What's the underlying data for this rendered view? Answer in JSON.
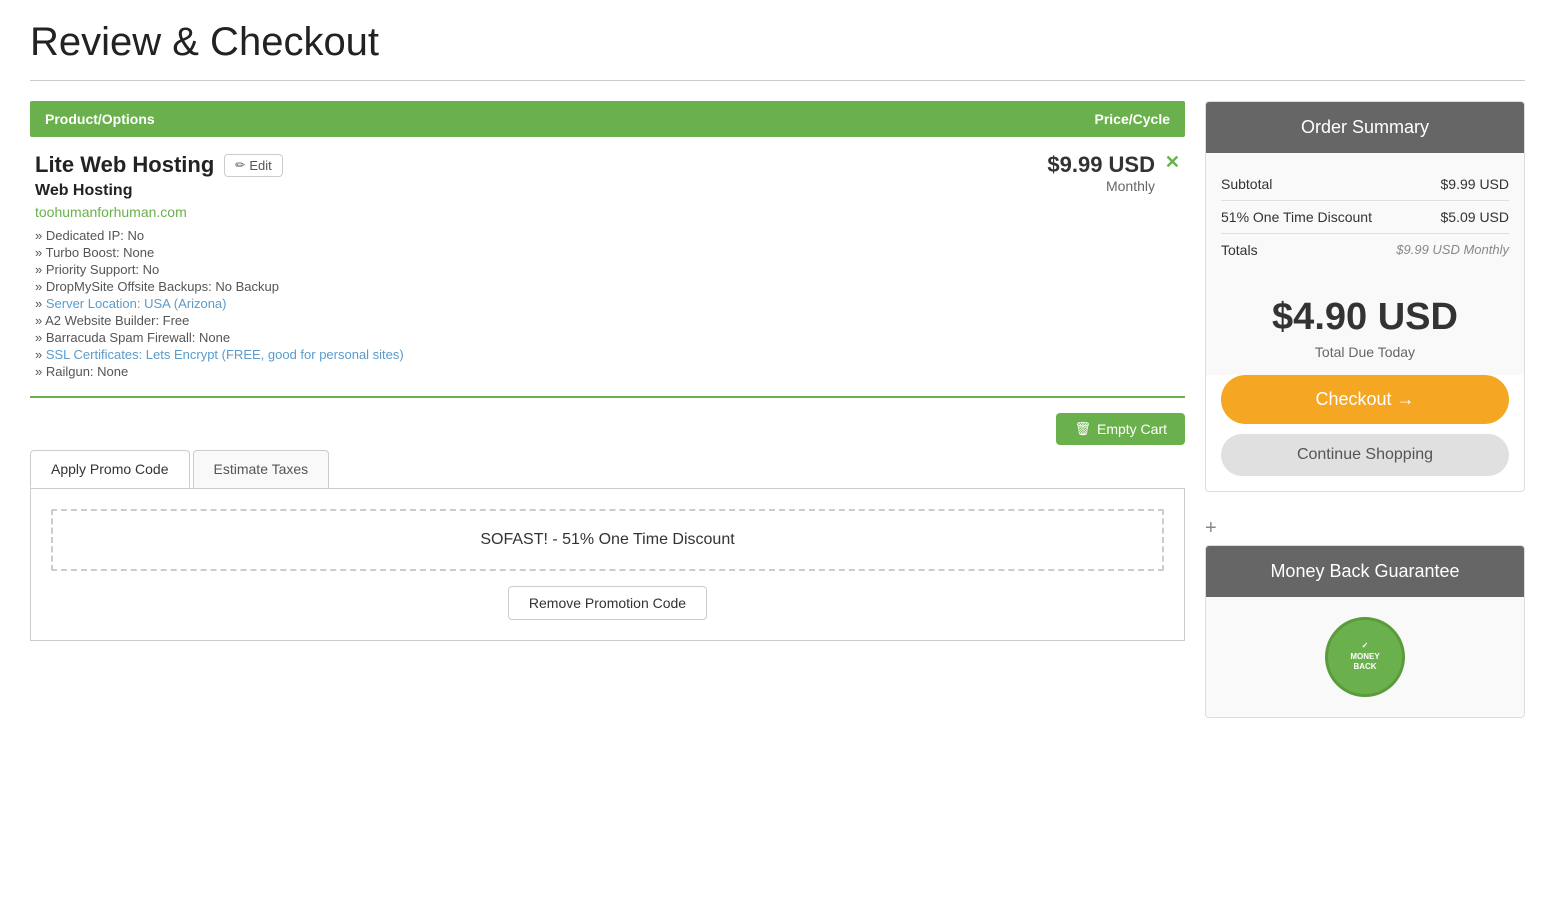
{
  "page": {
    "title": "Review & Checkout"
  },
  "table": {
    "col1": "Product/Options",
    "col2": "Price/Cycle"
  },
  "product": {
    "name": "Lite Web Hosting",
    "edit_label": "Edit",
    "type": "Web Hosting",
    "domain": "toohumanforhuman.com",
    "price": "$9.99 USD",
    "cycle": "Monthly",
    "options": [
      "Dedicated IP: No",
      "Turbo Boost: None",
      "Priority Support: No",
      "DropMySite Offsite Backups: No Backup",
      "Server Location: USA (Arizona)",
      "A2 Website Builder: Free",
      "Barracuda Spam Firewall: None",
      "SSL Certificates: Lets Encrypt (FREE, good for personal sites)",
      "Railgun: None"
    ]
  },
  "cart": {
    "empty_cart_label": "Empty Cart"
  },
  "tabs": {
    "tab1": "Apply Promo Code",
    "tab2": "Estimate Taxes"
  },
  "promo": {
    "applied_code": "SOFAST! - 51% One Time Discount",
    "remove_label": "Remove Promotion Code"
  },
  "order_summary": {
    "header": "Order Summary",
    "subtotal_label": "Subtotal",
    "subtotal_value": "$9.99 USD",
    "discount_label": "51% One Time Discount",
    "discount_value": "$5.09 USD",
    "totals_label": "Totals",
    "totals_value": "$9.99 USD Monthly",
    "big_price": "$4.90 USD",
    "total_due_label": "Total Due Today",
    "checkout_label": "Checkout →",
    "continue_shopping_label": "Continue Shopping"
  },
  "money_back": {
    "header": "Money Back Guarantee",
    "seal_text": "MONEY BACK"
  }
}
